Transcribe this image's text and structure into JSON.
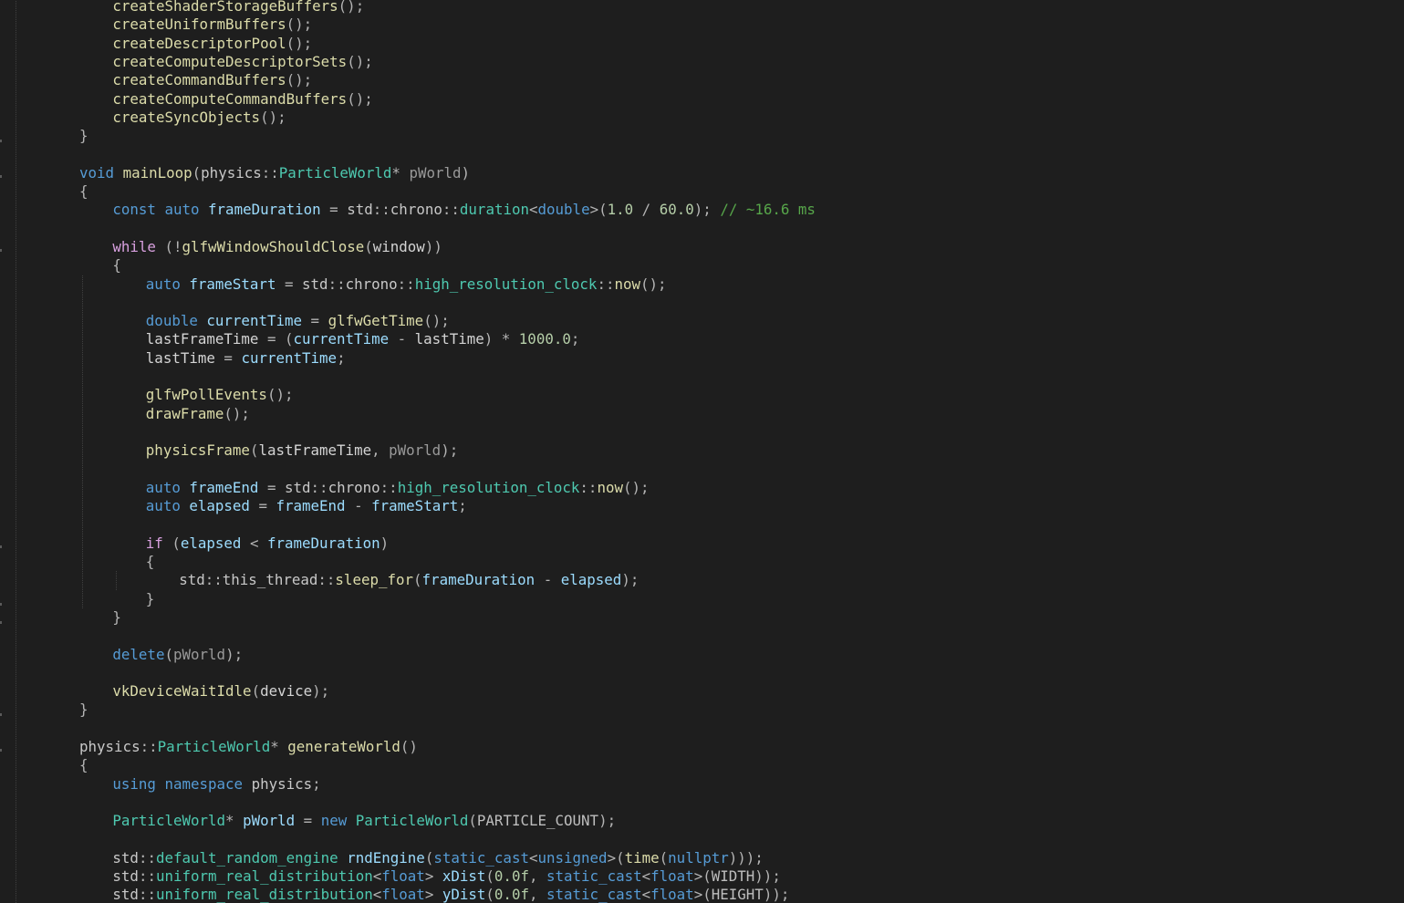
{
  "editor": {
    "lines": [
      {
        "id": 1,
        "indent": 1,
        "tokens": [
          {
            "t": "createShaderStorageBuffers",
            "k": "fn"
          },
          {
            "t": "();",
            "k": "pn"
          }
        ]
      },
      {
        "id": 2,
        "indent": 1,
        "tokens": [
          {
            "t": "createUniformBuffers",
            "k": "fn"
          },
          {
            "t": "();",
            "k": "pn"
          }
        ]
      },
      {
        "id": 3,
        "indent": 1,
        "tokens": [
          {
            "t": "createDescriptorPool",
            "k": "fn"
          },
          {
            "t": "();",
            "k": "pn"
          }
        ]
      },
      {
        "id": 4,
        "indent": 1,
        "tokens": [
          {
            "t": "createComputeDescriptorSets",
            "k": "fn"
          },
          {
            "t": "();",
            "k": "pn"
          }
        ]
      },
      {
        "id": 5,
        "indent": 1,
        "tokens": [
          {
            "t": "createCommandBuffers",
            "k": "fn"
          },
          {
            "t": "();",
            "k": "pn"
          }
        ]
      },
      {
        "id": 6,
        "indent": 1,
        "tokens": [
          {
            "t": "createComputeCommandBuffers",
            "k": "fn"
          },
          {
            "t": "();",
            "k": "pn"
          }
        ]
      },
      {
        "id": 7,
        "indent": 1,
        "tokens": [
          {
            "t": "createSyncObjects",
            "k": "fn"
          },
          {
            "t": "();",
            "k": "pn"
          }
        ]
      },
      {
        "id": 8,
        "indent": 0,
        "tokens": [
          {
            "t": "}",
            "k": "pn"
          }
        ]
      },
      {
        "id": 9,
        "indent": 0,
        "tokens": []
      },
      {
        "id": 10,
        "indent": 0,
        "tokens": [
          {
            "t": "void",
            "k": "kw"
          },
          {
            "t": " ",
            "k": "pl"
          },
          {
            "t": "mainLoop",
            "k": "fn"
          },
          {
            "t": "(",
            "k": "pn"
          },
          {
            "t": "physics",
            "k": "ns"
          },
          {
            "t": "::",
            "k": "pn"
          },
          {
            "t": "ParticleWorld",
            "k": "ty"
          },
          {
            "t": "* ",
            "k": "pn"
          },
          {
            "t": "pWorld",
            "k": "prm"
          },
          {
            "t": ")",
            "k": "pn"
          }
        ]
      },
      {
        "id": 11,
        "indent": 0,
        "tokens": [
          {
            "t": "{",
            "k": "pn"
          }
        ]
      },
      {
        "id": 12,
        "indent": 1,
        "tokens": [
          {
            "t": "const",
            "k": "kw"
          },
          {
            "t": " ",
            "k": "pl"
          },
          {
            "t": "auto",
            "k": "kw"
          },
          {
            "t": " ",
            "k": "pl"
          },
          {
            "t": "frameDuration",
            "k": "var"
          },
          {
            "t": " = ",
            "k": "pn"
          },
          {
            "t": "std",
            "k": "ns"
          },
          {
            "t": "::",
            "k": "pn"
          },
          {
            "t": "chrono",
            "k": "ns"
          },
          {
            "t": "::",
            "k": "pn"
          },
          {
            "t": "duration",
            "k": "ty"
          },
          {
            "t": "<",
            "k": "pn"
          },
          {
            "t": "double",
            "k": "kw"
          },
          {
            "t": ">(",
            "k": "pn"
          },
          {
            "t": "1.0",
            "k": "num"
          },
          {
            "t": " / ",
            "k": "pn"
          },
          {
            "t": "60.0",
            "k": "num"
          },
          {
            "t": "); ",
            "k": "pn"
          },
          {
            "t": "// ~16.6 ms",
            "k": "cmt"
          }
        ]
      },
      {
        "id": 13,
        "indent": 0,
        "tokens": []
      },
      {
        "id": 14,
        "indent": 1,
        "tokens": [
          {
            "t": "while",
            "k": "ctrl"
          },
          {
            "t": " (!",
            "k": "pn"
          },
          {
            "t": "glfwWindowShouldClose",
            "k": "fn"
          },
          {
            "t": "(",
            "k": "pn"
          },
          {
            "t": "window",
            "k": "pl"
          },
          {
            "t": "))",
            "k": "pn"
          }
        ]
      },
      {
        "id": 15,
        "indent": 1,
        "tokens": [
          {
            "t": "{",
            "k": "pn"
          }
        ]
      },
      {
        "id": 16,
        "indent": 2,
        "tokens": [
          {
            "t": "auto",
            "k": "kw"
          },
          {
            "t": " ",
            "k": "pl"
          },
          {
            "t": "frameStart",
            "k": "var"
          },
          {
            "t": " = ",
            "k": "pn"
          },
          {
            "t": "std",
            "k": "ns"
          },
          {
            "t": "::",
            "k": "pn"
          },
          {
            "t": "chrono",
            "k": "ns"
          },
          {
            "t": "::",
            "k": "pn"
          },
          {
            "t": "high_resolution_clock",
            "k": "ty"
          },
          {
            "t": "::",
            "k": "pn"
          },
          {
            "t": "now",
            "k": "fn"
          },
          {
            "t": "();",
            "k": "pn"
          }
        ]
      },
      {
        "id": 17,
        "indent": 0,
        "tokens": []
      },
      {
        "id": 18,
        "indent": 2,
        "tokens": [
          {
            "t": "double",
            "k": "kw"
          },
          {
            "t": " ",
            "k": "pl"
          },
          {
            "t": "currentTime",
            "k": "var"
          },
          {
            "t": " = ",
            "k": "pn"
          },
          {
            "t": "glfwGetTime",
            "k": "fn"
          },
          {
            "t": "();",
            "k": "pn"
          }
        ]
      },
      {
        "id": 19,
        "indent": 2,
        "tokens": [
          {
            "t": "lastFrameTime",
            "k": "pl"
          },
          {
            "t": " = (",
            "k": "pn"
          },
          {
            "t": "currentTime",
            "k": "var"
          },
          {
            "t": " - ",
            "k": "pn"
          },
          {
            "t": "lastTime",
            "k": "pl"
          },
          {
            "t": ") * ",
            "k": "pn"
          },
          {
            "t": "1000.0",
            "k": "num"
          },
          {
            "t": ";",
            "k": "pn"
          }
        ]
      },
      {
        "id": 20,
        "indent": 2,
        "tokens": [
          {
            "t": "lastTime",
            "k": "pl"
          },
          {
            "t": " = ",
            "k": "pn"
          },
          {
            "t": "currentTime",
            "k": "var"
          },
          {
            "t": ";",
            "k": "pn"
          }
        ]
      },
      {
        "id": 21,
        "indent": 0,
        "tokens": []
      },
      {
        "id": 22,
        "indent": 2,
        "tokens": [
          {
            "t": "glfwPollEvents",
            "k": "fn"
          },
          {
            "t": "();",
            "k": "pn"
          }
        ]
      },
      {
        "id": 23,
        "indent": 2,
        "tokens": [
          {
            "t": "drawFrame",
            "k": "fn"
          },
          {
            "t": "();",
            "k": "pn"
          }
        ]
      },
      {
        "id": 24,
        "indent": 0,
        "tokens": []
      },
      {
        "id": 25,
        "indent": 2,
        "tokens": [
          {
            "t": "physicsFrame",
            "k": "fn"
          },
          {
            "t": "(",
            "k": "pn"
          },
          {
            "t": "lastFrameTime",
            "k": "pl"
          },
          {
            "t": ", ",
            "k": "pn"
          },
          {
            "t": "pWorld",
            "k": "prm"
          },
          {
            "t": ");",
            "k": "pn"
          }
        ]
      },
      {
        "id": 26,
        "indent": 0,
        "tokens": []
      },
      {
        "id": 27,
        "indent": 2,
        "tokens": [
          {
            "t": "auto",
            "k": "kw"
          },
          {
            "t": " ",
            "k": "pl"
          },
          {
            "t": "frameEnd",
            "k": "var"
          },
          {
            "t": " = ",
            "k": "pn"
          },
          {
            "t": "std",
            "k": "ns"
          },
          {
            "t": "::",
            "k": "pn"
          },
          {
            "t": "chrono",
            "k": "ns"
          },
          {
            "t": "::",
            "k": "pn"
          },
          {
            "t": "high_resolution_clock",
            "k": "ty"
          },
          {
            "t": "::",
            "k": "pn"
          },
          {
            "t": "now",
            "k": "fn"
          },
          {
            "t": "();",
            "k": "pn"
          }
        ]
      },
      {
        "id": 28,
        "indent": 2,
        "tokens": [
          {
            "t": "auto",
            "k": "kw"
          },
          {
            "t": " ",
            "k": "pl"
          },
          {
            "t": "elapsed",
            "k": "var"
          },
          {
            "t": " = ",
            "k": "pn"
          },
          {
            "t": "frameEnd",
            "k": "var"
          },
          {
            "t": " - ",
            "k": "pn"
          },
          {
            "t": "frameStart",
            "k": "var"
          },
          {
            "t": ";",
            "k": "pn"
          }
        ]
      },
      {
        "id": 29,
        "indent": 0,
        "tokens": []
      },
      {
        "id": 30,
        "indent": 2,
        "tokens": [
          {
            "t": "if",
            "k": "ctrl"
          },
          {
            "t": " (",
            "k": "pn"
          },
          {
            "t": "elapsed",
            "k": "var"
          },
          {
            "t": " < ",
            "k": "pn"
          },
          {
            "t": "frameDuration",
            "k": "var"
          },
          {
            "t": ")",
            "k": "pn"
          }
        ]
      },
      {
        "id": 31,
        "indent": 2,
        "tokens": [
          {
            "t": "{",
            "k": "pn"
          }
        ]
      },
      {
        "id": 32,
        "indent": 3,
        "tokens": [
          {
            "t": "std",
            "k": "ns"
          },
          {
            "t": "::",
            "k": "pn"
          },
          {
            "t": "this_thread",
            "k": "ns"
          },
          {
            "t": "::",
            "k": "pn"
          },
          {
            "t": "sleep_for",
            "k": "fn"
          },
          {
            "t": "(",
            "k": "pn"
          },
          {
            "t": "frameDuration",
            "k": "var"
          },
          {
            "t": " - ",
            "k": "pn"
          },
          {
            "t": "elapsed",
            "k": "var"
          },
          {
            "t": ");",
            "k": "pn"
          }
        ]
      },
      {
        "id": 33,
        "indent": 2,
        "tokens": [
          {
            "t": "}",
            "k": "pn"
          }
        ]
      },
      {
        "id": 34,
        "indent": 1,
        "tokens": [
          {
            "t": "}",
            "k": "pn"
          }
        ]
      },
      {
        "id": 35,
        "indent": 0,
        "tokens": []
      },
      {
        "id": 36,
        "indent": 1,
        "tokens": [
          {
            "t": "delete",
            "k": "kw"
          },
          {
            "t": "(",
            "k": "pn"
          },
          {
            "t": "pWorld",
            "k": "prm"
          },
          {
            "t": ");",
            "k": "pn"
          }
        ]
      },
      {
        "id": 37,
        "indent": 0,
        "tokens": []
      },
      {
        "id": 38,
        "indent": 1,
        "tokens": [
          {
            "t": "vkDeviceWaitIdle",
            "k": "fn"
          },
          {
            "t": "(",
            "k": "pn"
          },
          {
            "t": "device",
            "k": "pl"
          },
          {
            "t": ");",
            "k": "pn"
          }
        ]
      },
      {
        "id": 39,
        "indent": 0,
        "tokens": [
          {
            "t": "}",
            "k": "pn"
          }
        ]
      },
      {
        "id": 40,
        "indent": 0,
        "tokens": []
      },
      {
        "id": 41,
        "indent": 0,
        "tokens": [
          {
            "t": "physics",
            "k": "ns"
          },
          {
            "t": "::",
            "k": "pn"
          },
          {
            "t": "ParticleWorld",
            "k": "ty"
          },
          {
            "t": "* ",
            "k": "pn"
          },
          {
            "t": "generateWorld",
            "k": "fn"
          },
          {
            "t": "()",
            "k": "pn"
          }
        ]
      },
      {
        "id": 42,
        "indent": 0,
        "tokens": [
          {
            "t": "{",
            "k": "pn"
          }
        ]
      },
      {
        "id": 43,
        "indent": 1,
        "tokens": [
          {
            "t": "using",
            "k": "kw"
          },
          {
            "t": " ",
            "k": "pl"
          },
          {
            "t": "namespace",
            "k": "kw"
          },
          {
            "t": " ",
            "k": "pl"
          },
          {
            "t": "physics",
            "k": "ns"
          },
          {
            "t": ";",
            "k": "pn"
          }
        ]
      },
      {
        "id": 44,
        "indent": 0,
        "tokens": []
      },
      {
        "id": 45,
        "indent": 1,
        "tokens": [
          {
            "t": "ParticleWorld",
            "k": "ty"
          },
          {
            "t": "* ",
            "k": "pn"
          },
          {
            "t": "pWorld",
            "k": "var"
          },
          {
            "t": " = ",
            "k": "pn"
          },
          {
            "t": "new",
            "k": "kw"
          },
          {
            "t": " ",
            "k": "pl"
          },
          {
            "t": "ParticleWorld",
            "k": "ty"
          },
          {
            "t": "(",
            "k": "pn"
          },
          {
            "t": "PARTICLE_COUNT",
            "k": "mac"
          },
          {
            "t": ");",
            "k": "pn"
          }
        ]
      },
      {
        "id": 46,
        "indent": 0,
        "tokens": []
      },
      {
        "id": 47,
        "indent": 1,
        "tokens": [
          {
            "t": "std",
            "k": "ns"
          },
          {
            "t": "::",
            "k": "pn"
          },
          {
            "t": "default_random_engine",
            "k": "ty"
          },
          {
            "t": " ",
            "k": "pl"
          },
          {
            "t": "rndEngine",
            "k": "var"
          },
          {
            "t": "(",
            "k": "pn"
          },
          {
            "t": "static_cast",
            "k": "kw"
          },
          {
            "t": "<",
            "k": "pn"
          },
          {
            "t": "unsigned",
            "k": "kw"
          },
          {
            "t": ">(",
            "k": "pn"
          },
          {
            "t": "time",
            "k": "fn"
          },
          {
            "t": "(",
            "k": "pn"
          },
          {
            "t": "nullptr",
            "k": "kw"
          },
          {
            "t": ")));",
            "k": "pn"
          }
        ]
      },
      {
        "id": 48,
        "indent": 1,
        "tokens": [
          {
            "t": "std",
            "k": "ns"
          },
          {
            "t": "::",
            "k": "pn"
          },
          {
            "t": "uniform_real_distribution",
            "k": "ty"
          },
          {
            "t": "<",
            "k": "pn"
          },
          {
            "t": "float",
            "k": "kw"
          },
          {
            "t": "> ",
            "k": "pn"
          },
          {
            "t": "xDist",
            "k": "var"
          },
          {
            "t": "(",
            "k": "pn"
          },
          {
            "t": "0.0f",
            "k": "num"
          },
          {
            "t": ", ",
            "k": "pn"
          },
          {
            "t": "static_cast",
            "k": "kw"
          },
          {
            "t": "<",
            "k": "pn"
          },
          {
            "t": "float",
            "k": "kw"
          },
          {
            "t": ">(",
            "k": "pn"
          },
          {
            "t": "WIDTH",
            "k": "mac"
          },
          {
            "t": "));",
            "k": "pn"
          }
        ]
      },
      {
        "id": 49,
        "indent": 1,
        "tokens": [
          {
            "t": "std",
            "k": "ns"
          },
          {
            "t": "::",
            "k": "pn"
          },
          {
            "t": "uniform_real_distribution",
            "k": "ty"
          },
          {
            "t": "<",
            "k": "pn"
          },
          {
            "t": "float",
            "k": "kw"
          },
          {
            "t": "> ",
            "k": "pn"
          },
          {
            "t": "yDist",
            "k": "var"
          },
          {
            "t": "(",
            "k": "pn"
          },
          {
            "t": "0.0f",
            "k": "num"
          },
          {
            "t": ", ",
            "k": "pn"
          },
          {
            "t": "static_cast",
            "k": "kw"
          },
          {
            "t": "<",
            "k": "pn"
          },
          {
            "t": "float",
            "k": "kw"
          },
          {
            "t": ">(",
            "k": "pn"
          },
          {
            "t": "HEIGHT",
            "k": "mac"
          },
          {
            "t": "));",
            "k": "pn"
          }
        ]
      }
    ]
  }
}
